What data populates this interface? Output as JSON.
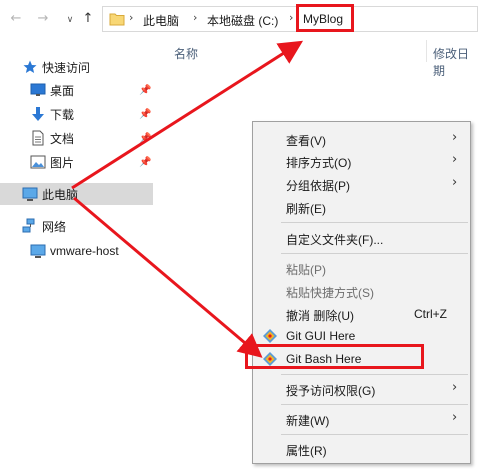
{
  "address_bar": {
    "breadcrumbs": [
      "此电脑",
      "本地磁盘 (C:)",
      "MyBlog"
    ]
  },
  "columns": {
    "name": "名称",
    "date": "修改日期"
  },
  "sidebar": {
    "items": [
      {
        "label": "快速访问",
        "icon": "star-icon"
      },
      {
        "label": "桌面",
        "icon": "desktop-icon",
        "pinned": true
      },
      {
        "label": "下载",
        "icon": "download-icon",
        "pinned": true
      },
      {
        "label": "文档",
        "icon": "document-icon",
        "pinned": true
      },
      {
        "label": "图片",
        "icon": "pictures-icon",
        "pinned": true
      },
      {
        "label": "此电脑",
        "icon": "computer-icon",
        "selected": true
      },
      {
        "label": "网络",
        "icon": "network-icon"
      },
      {
        "label": "vmware-host",
        "icon": "monitor-icon"
      }
    ]
  },
  "context_menu": {
    "items": [
      {
        "label": "查看(V)",
        "submenu": true
      },
      {
        "label": "排序方式(O)",
        "submenu": true
      },
      {
        "label": "分组依据(P)",
        "submenu": true
      },
      {
        "label": "刷新(E)"
      },
      {
        "label": "自定义文件夹(F)..."
      },
      {
        "label": "粘贴(P)",
        "disabled": true
      },
      {
        "label": "粘贴快捷方式(S)",
        "disabled": true
      },
      {
        "label": "撤消 删除(U)",
        "shortcut": "Ctrl+Z"
      },
      {
        "label": "Git GUI Here",
        "icon": "git-gui-icon"
      },
      {
        "label": "Git Bash Here",
        "icon": "git-bash-icon",
        "highlighted": true
      },
      {
        "label": "授予访问权限(G)",
        "submenu": true
      },
      {
        "label": "新建(W)",
        "submenu": true
      },
      {
        "label": "属性(R)"
      }
    ]
  },
  "colors": {
    "annotation_red": "#e8161d",
    "menu_bg": "#f2f2f2",
    "selected_bg": "#d9d9d9",
    "column_header": "#4c607a"
  }
}
